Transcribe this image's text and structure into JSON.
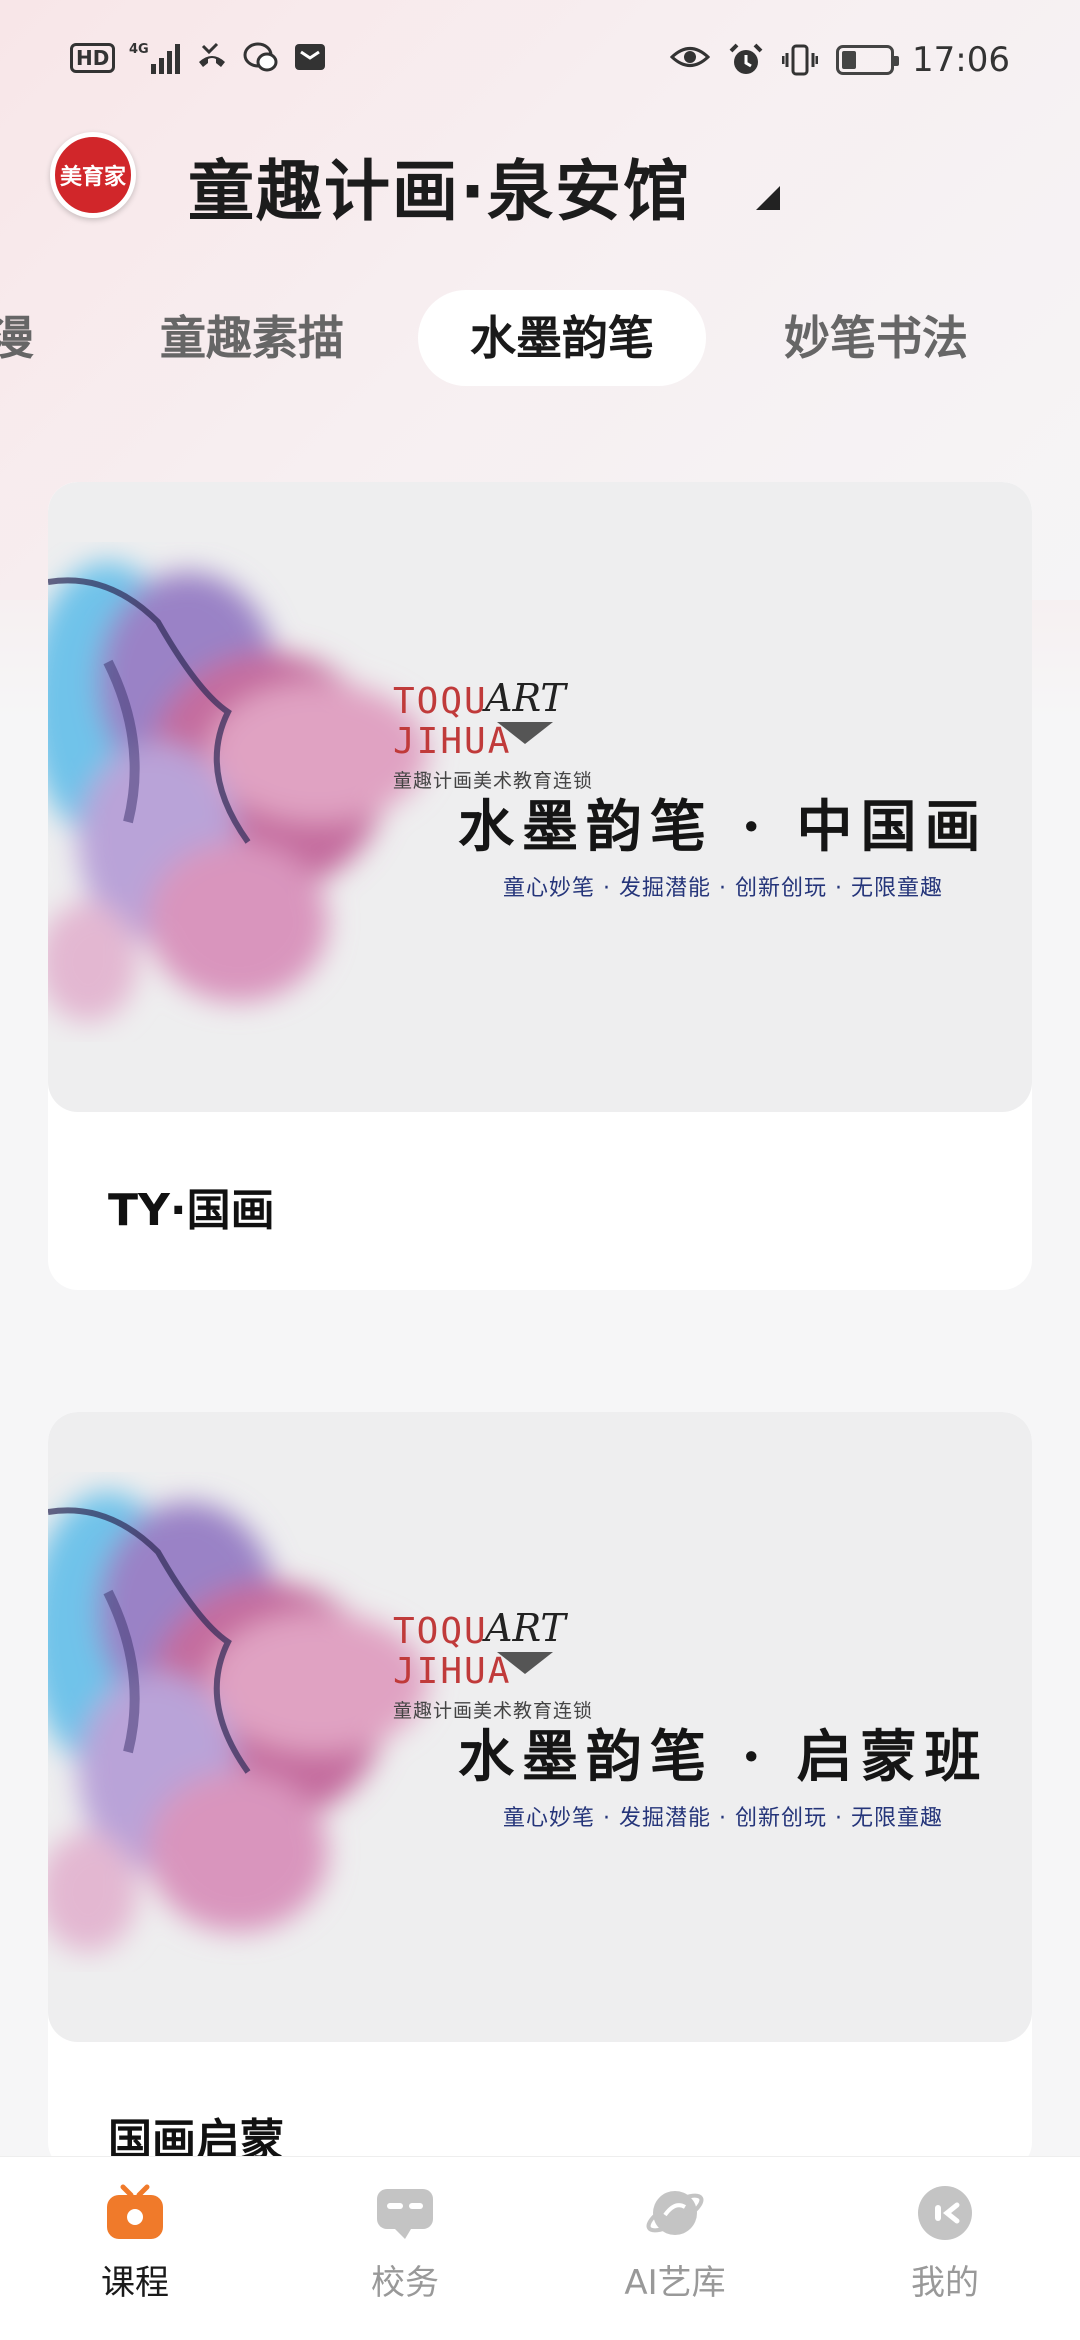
{
  "status_bar": {
    "network_hd": "HD",
    "network_gen": "4G",
    "time": "17:06",
    "battery_level": 0.3
  },
  "header": {
    "logo_text": "美育家",
    "school_name": "童趣计画·泉安馆"
  },
  "tabs": [
    {
      "label": "漫",
      "active": false
    },
    {
      "label": "童趣素描",
      "active": false
    },
    {
      "label": "水墨韵笔",
      "active": true
    },
    {
      "label": "妙笔书法",
      "active": false
    }
  ],
  "courses": [
    {
      "title": "TY·国画",
      "banner": {
        "brand_en_1": "TOQU",
        "brand_en_2": "JIHUA",
        "brand_art": "ART",
        "brand_cn": "童趣计画美术教育连锁",
        "headline": "水墨韵笔 · 中国画",
        "slogan": "童心妙笔 · 发掘潜能 · 创新创玩 · 无限童趣"
      }
    },
    {
      "title": "国画启蒙",
      "banner": {
        "brand_en_1": "TOQU",
        "brand_en_2": "JIHUA",
        "brand_art": "ART",
        "brand_cn": "童趣计画美术教育连锁",
        "headline": "水墨韵笔 · 启蒙班",
        "slogan": "童心妙笔 · 发掘潜能 · 创新创玩 · 无限童趣"
      }
    }
  ],
  "bottom_nav": [
    {
      "label": "课程",
      "icon": "tv-icon",
      "active": true
    },
    {
      "label": "校务",
      "icon": "chat-icon",
      "active": false
    },
    {
      "label": "AI艺库",
      "icon": "planet-icon",
      "active": false
    },
    {
      "label": "我的",
      "icon": "profile-icon",
      "active": false
    }
  ],
  "colors": {
    "accent_orange": "#f07a2a",
    "logo_red": "#d1262a",
    "nav_inactive": "#c4c4c4"
  }
}
